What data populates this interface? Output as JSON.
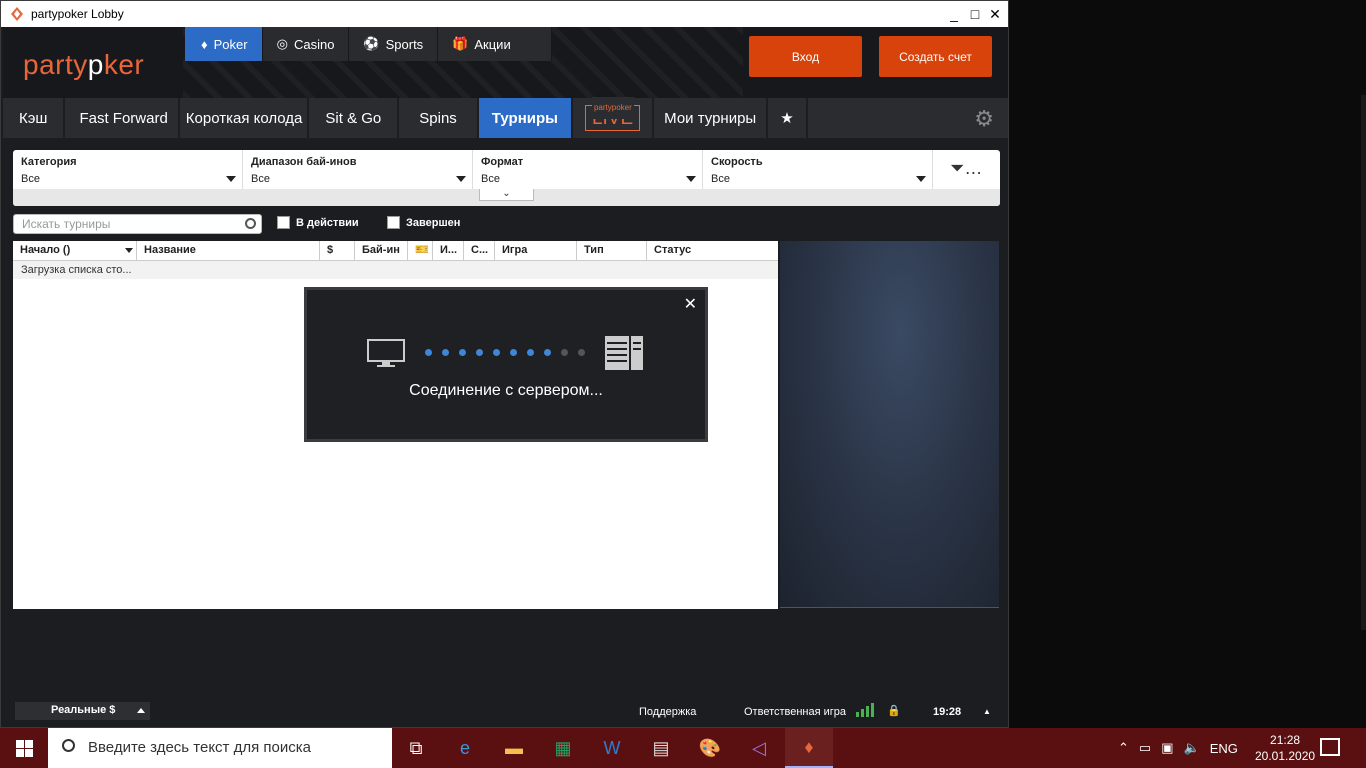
{
  "window": {
    "title": "partypoker Lobby",
    "min_label": "_",
    "max_label": "□",
    "close_label": "✕"
  },
  "header": {
    "logo_text_a": "party",
    "logo_text_b": "p",
    "logo_text_c": "ker",
    "topnav": [
      {
        "label": "Poker",
        "icon": "spade-diamond-icon"
      },
      {
        "label": "Casino",
        "icon": "chip-icon"
      },
      {
        "label": "Sports",
        "icon": "soccer-ball-icon"
      },
      {
        "label": "Акции",
        "icon": "gift-icon"
      }
    ],
    "login_label": "Вход",
    "register_label": "Создать счет"
  },
  "tabs": [
    "Кэш",
    "Fast Forward",
    "Короткая колода",
    "Sit & Go",
    "Spins",
    "Турниры",
    "LIVE",
    "Мои турниры"
  ],
  "live_small": "partypoker",
  "filters": [
    {
      "label": "Категория",
      "value": "Все"
    },
    {
      "label": "Диапазон бай-инов",
      "value": "Все"
    },
    {
      "label": "Формат",
      "value": "Все"
    },
    {
      "label": "Скорость",
      "value": "Все"
    }
  ],
  "filter_more": "…",
  "search": {
    "placeholder": "Искать турниры"
  },
  "checkboxes": {
    "in_action": "В действии",
    "finished": "Завершен"
  },
  "table": {
    "columns": [
      "Начало ()",
      "Название",
      "$",
      "Бай-ин",
      "",
      "И...",
      "С...",
      "Игра",
      "Тип",
      "Статус"
    ],
    "loading_row": "Загрузка списка сто..."
  },
  "dialog": {
    "message": "Соединение с сервером...",
    "close": "✕",
    "progress_active": 8,
    "progress_total": 10
  },
  "status": {
    "mode": "Реальные $",
    "support": "Поддержка",
    "responsible": "Ответственная игра",
    "time": "19:28",
    "more": "▲"
  },
  "taskbar": {
    "search_placeholder": "Введите здесь текст для поиска",
    "lang": "ENG",
    "clock_time": "21:28",
    "clock_date": "20.01.2020"
  },
  "colors": {
    "accent_blue": "#2c6cc7",
    "brand_orange": "#d8420b",
    "progress_dot": "#3d86d8"
  }
}
